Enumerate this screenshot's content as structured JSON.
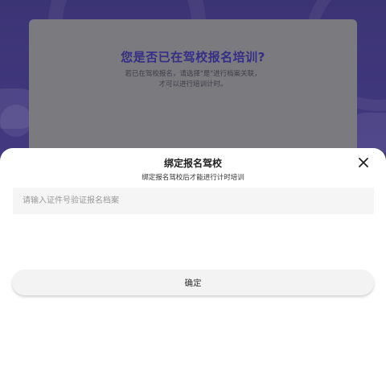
{
  "background_dialog": {
    "title": "您是否已在驾校报名培训?",
    "desc_line1": "若已在驾校报名，请选择\"是\"进行档案关联，",
    "desc_line2": "才可以进行培训计时。"
  },
  "sheet": {
    "title": "绑定报名驾校",
    "subtitle": "绑定报名驾校后才能进行计时培训",
    "close_icon": "close-icon",
    "input_placeholder": "请输入证件号验证报名档案",
    "input_value": "",
    "confirm_label": "确定"
  },
  "colors": {
    "background_purple": "#413877",
    "dialog_gray": "#7b7a7f",
    "dialog_title": "#352e86",
    "sheet_bg": "#ffffff",
    "input_bg": "#f5f5f5",
    "button_bg": "#f3f3f3"
  }
}
